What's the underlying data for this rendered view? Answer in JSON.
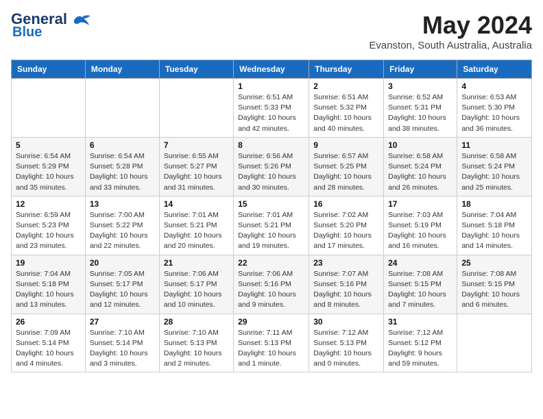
{
  "header": {
    "logo_line1": "General",
    "logo_line2": "Blue",
    "month": "May 2024",
    "location": "Evanston, South Australia, Australia"
  },
  "columns": [
    "Sunday",
    "Monday",
    "Tuesday",
    "Wednesday",
    "Thursday",
    "Friday",
    "Saturday"
  ],
  "weeks": [
    [
      {
        "day": "",
        "info": ""
      },
      {
        "day": "",
        "info": ""
      },
      {
        "day": "",
        "info": ""
      },
      {
        "day": "1",
        "info": "Sunrise: 6:51 AM\nSunset: 5:33 PM\nDaylight: 10 hours\nand 42 minutes."
      },
      {
        "day": "2",
        "info": "Sunrise: 6:51 AM\nSunset: 5:32 PM\nDaylight: 10 hours\nand 40 minutes."
      },
      {
        "day": "3",
        "info": "Sunrise: 6:52 AM\nSunset: 5:31 PM\nDaylight: 10 hours\nand 38 minutes."
      },
      {
        "day": "4",
        "info": "Sunrise: 6:53 AM\nSunset: 5:30 PM\nDaylight: 10 hours\nand 36 minutes."
      }
    ],
    [
      {
        "day": "5",
        "info": "Sunrise: 6:54 AM\nSunset: 5:29 PM\nDaylight: 10 hours\nand 35 minutes."
      },
      {
        "day": "6",
        "info": "Sunrise: 6:54 AM\nSunset: 5:28 PM\nDaylight: 10 hours\nand 33 minutes."
      },
      {
        "day": "7",
        "info": "Sunrise: 6:55 AM\nSunset: 5:27 PM\nDaylight: 10 hours\nand 31 minutes."
      },
      {
        "day": "8",
        "info": "Sunrise: 6:56 AM\nSunset: 5:26 PM\nDaylight: 10 hours\nand 30 minutes."
      },
      {
        "day": "9",
        "info": "Sunrise: 6:57 AM\nSunset: 5:25 PM\nDaylight: 10 hours\nand 28 minutes."
      },
      {
        "day": "10",
        "info": "Sunrise: 6:58 AM\nSunset: 5:24 PM\nDaylight: 10 hours\nand 26 minutes."
      },
      {
        "day": "11",
        "info": "Sunrise: 6:58 AM\nSunset: 5:24 PM\nDaylight: 10 hours\nand 25 minutes."
      }
    ],
    [
      {
        "day": "12",
        "info": "Sunrise: 6:59 AM\nSunset: 5:23 PM\nDaylight: 10 hours\nand 23 minutes."
      },
      {
        "day": "13",
        "info": "Sunrise: 7:00 AM\nSunset: 5:22 PM\nDaylight: 10 hours\nand 22 minutes."
      },
      {
        "day": "14",
        "info": "Sunrise: 7:01 AM\nSunset: 5:21 PM\nDaylight: 10 hours\nand 20 minutes."
      },
      {
        "day": "15",
        "info": "Sunrise: 7:01 AM\nSunset: 5:21 PM\nDaylight: 10 hours\nand 19 minutes."
      },
      {
        "day": "16",
        "info": "Sunrise: 7:02 AM\nSunset: 5:20 PM\nDaylight: 10 hours\nand 17 minutes."
      },
      {
        "day": "17",
        "info": "Sunrise: 7:03 AM\nSunset: 5:19 PM\nDaylight: 10 hours\nand 16 minutes."
      },
      {
        "day": "18",
        "info": "Sunrise: 7:04 AM\nSunset: 5:18 PM\nDaylight: 10 hours\nand 14 minutes."
      }
    ],
    [
      {
        "day": "19",
        "info": "Sunrise: 7:04 AM\nSunset: 5:18 PM\nDaylight: 10 hours\nand 13 minutes."
      },
      {
        "day": "20",
        "info": "Sunrise: 7:05 AM\nSunset: 5:17 PM\nDaylight: 10 hours\nand 12 minutes."
      },
      {
        "day": "21",
        "info": "Sunrise: 7:06 AM\nSunset: 5:17 PM\nDaylight: 10 hours\nand 10 minutes."
      },
      {
        "day": "22",
        "info": "Sunrise: 7:06 AM\nSunset: 5:16 PM\nDaylight: 10 hours\nand 9 minutes."
      },
      {
        "day": "23",
        "info": "Sunrise: 7:07 AM\nSunset: 5:16 PM\nDaylight: 10 hours\nand 8 minutes."
      },
      {
        "day": "24",
        "info": "Sunrise: 7:08 AM\nSunset: 5:15 PM\nDaylight: 10 hours\nand 7 minutes."
      },
      {
        "day": "25",
        "info": "Sunrise: 7:08 AM\nSunset: 5:15 PM\nDaylight: 10 hours\nand 6 minutes."
      }
    ],
    [
      {
        "day": "26",
        "info": "Sunrise: 7:09 AM\nSunset: 5:14 PM\nDaylight: 10 hours\nand 4 minutes."
      },
      {
        "day": "27",
        "info": "Sunrise: 7:10 AM\nSunset: 5:14 PM\nDaylight: 10 hours\nand 3 minutes."
      },
      {
        "day": "28",
        "info": "Sunrise: 7:10 AM\nSunset: 5:13 PM\nDaylight: 10 hours\nand 2 minutes."
      },
      {
        "day": "29",
        "info": "Sunrise: 7:11 AM\nSunset: 5:13 PM\nDaylight: 10 hours\nand 1 minute."
      },
      {
        "day": "30",
        "info": "Sunrise: 7:12 AM\nSunset: 5:13 PM\nDaylight: 10 hours\nand 0 minutes."
      },
      {
        "day": "31",
        "info": "Sunrise: 7:12 AM\nSunset: 5:12 PM\nDaylight: 9 hours\nand 59 minutes."
      },
      {
        "day": "",
        "info": ""
      }
    ]
  ]
}
